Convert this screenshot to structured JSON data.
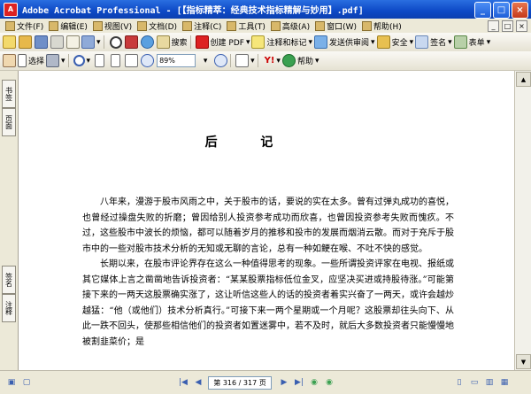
{
  "window": {
    "title": "Adobe Acrobat Professional - [【指标精萃：经典技术指标精解与妙用】.pdf]",
    "app_icon": "A",
    "buttons": [
      "_",
      "□",
      "×"
    ]
  },
  "menubar": {
    "items": [
      {
        "label": "文件(F)"
      },
      {
        "label": "编辑(E)"
      },
      {
        "label": "视图(V)"
      },
      {
        "label": "文档(D)"
      },
      {
        "label": "注释(C)"
      },
      {
        "label": "工具(T)"
      },
      {
        "label": "高级(A)"
      },
      {
        "label": "窗口(W)"
      },
      {
        "label": "帮助(H)"
      }
    ],
    "right_buttons": [
      "_",
      "□",
      "×"
    ]
  },
  "toolbar1": {
    "search_label": "搜索",
    "create_pdf_label": "创建 PDF",
    "combine_label": "注释和标记",
    "send_review_label": "发送供审阅",
    "secure_label": "安全",
    "sign_label": "签名",
    "form_label": "表单"
  },
  "toolbar2": {
    "select_label": "选择",
    "zoom_value": "89%",
    "help_label": "帮助"
  },
  "nav_panel": {
    "tab_top": "书签",
    "tab_pages": "页面",
    "tab_bottom1": "签名",
    "tab_bottom2": "注释"
  },
  "document": {
    "heading": "后 记",
    "paragraphs": [
      "八年来，漫游于股市风雨之中，关于股市的话，要说的实在太多。曾有过弹丸成功的喜悦，也曾经过操盘失败的折磨；曾因给别人投资参考成功而欣喜，也曾因投资参考失败而愧疚。不过，这些股市中波长的烦恼，都可以随着岁月的推移和投市的发展而烟消云散。而对于充斥于股市中的一些对股市技术分析的无知或无聊的言论，总有一种如鲠在喉、不吐不快的感觉。",
      "长期以来，在股市评论界存在这么一种值得思考的现象。一些所谓投资评家在电视、报纸或其它媒体上言之凿凿地告诉投资者：“某某股票指标低位金叉，应坚决买进或持股待涨。”可能第接下来的一两天这股票确实涨了，这让听信这些人的话的投资者着实兴奋了一两天，或许会越炒越猛：“他（或他们）技术分析真行。”可接下来一两个星期或一个月呢？这股票却往头向下、从此一跌不回头，使那些相信他们的投资者如置迷雾中，若不及时，就后大多数投资者只能慢慢地被割韭菜价；是"
    ]
  },
  "statusbar": {
    "page_display": "第 316 / 317 页"
  },
  "colors": {
    "titlebar": "#0d49c6",
    "chrome": "#ece9d8",
    "accent_red": "#d22222"
  }
}
